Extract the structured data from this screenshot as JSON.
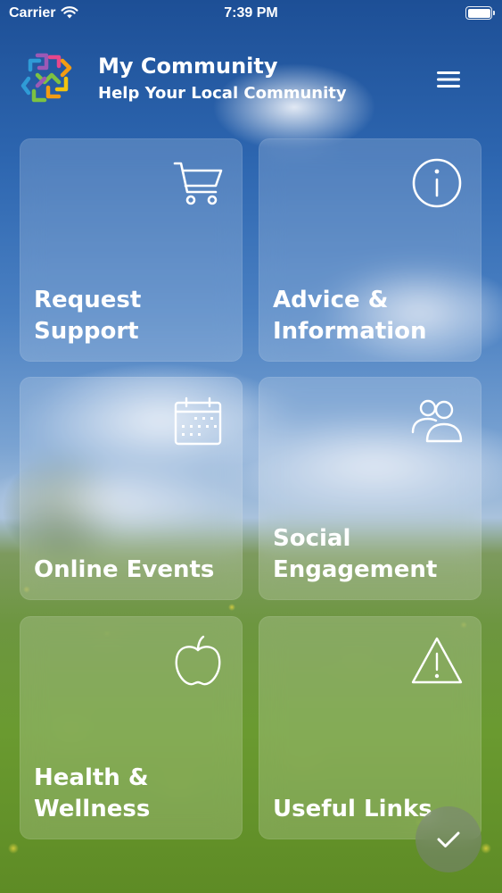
{
  "status_bar": {
    "carrier": "Carrier",
    "time": "7:39 PM",
    "wifi_icon": "wifi-icon",
    "battery_icon": "battery-full-icon"
  },
  "header": {
    "logo_icon": "community-logo-icon",
    "title": "My Community",
    "subtitle": "Help Your Local Community",
    "menu_icon": "hamburger-menu-icon"
  },
  "tiles": [
    {
      "label": "Request Support",
      "icon": "shopping-cart-icon"
    },
    {
      "label": "Advice &\nInformation",
      "icon": "info-icon"
    },
    {
      "label": "Online Events",
      "icon": "calendar-icon"
    },
    {
      "label": "Social\nEngagement",
      "icon": "people-icon"
    },
    {
      "label": "Health &\nWellness",
      "icon": "apple-icon"
    },
    {
      "label": "Useful Links",
      "icon": "warning-icon"
    }
  ],
  "fab": {
    "icon": "checkmark-icon"
  },
  "colors": {
    "text": "#FFFFFF",
    "logo_green": "#7CC242",
    "logo_blue": "#2F9BD6",
    "logo_purple": "#9B59B6",
    "logo_pink": "#E6478C",
    "logo_orange": "#F39C12",
    "logo_yellow": "#F1C40F"
  }
}
